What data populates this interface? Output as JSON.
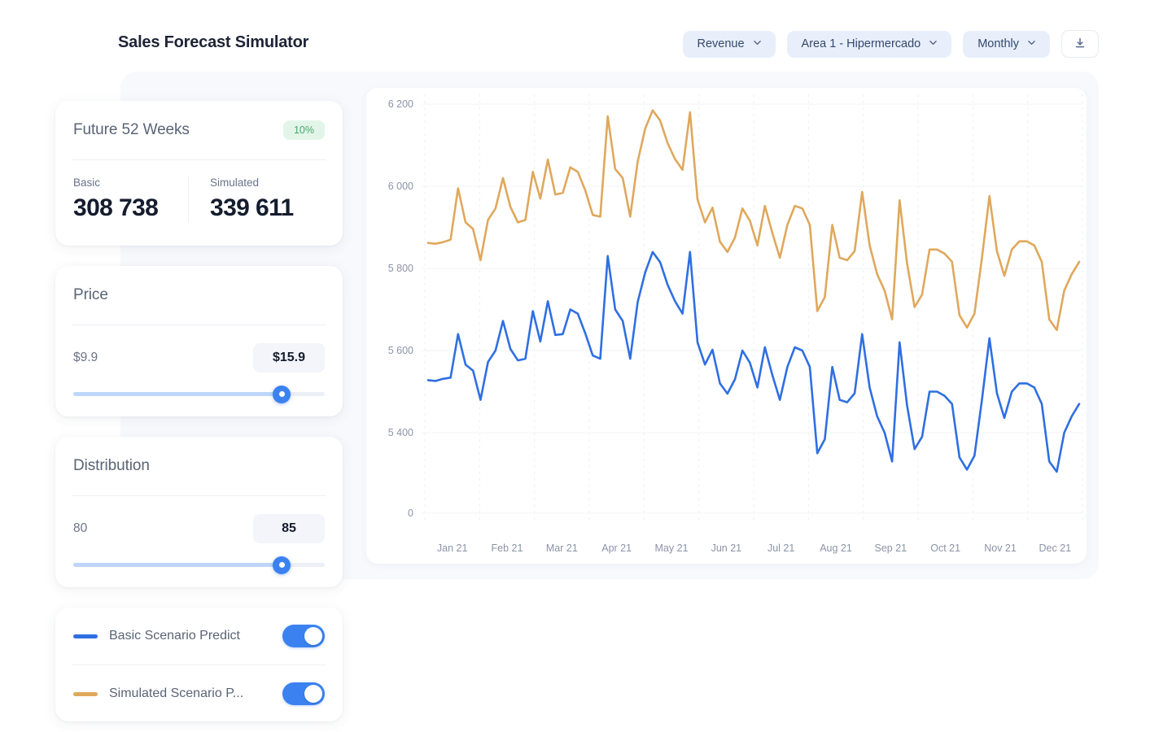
{
  "header": {
    "title": "Sales Forecast Simulator",
    "controls": [
      {
        "name": "metric",
        "label": "Revenue",
        "icon": "chevron-down-icon"
      },
      {
        "name": "area",
        "label": "Area 1 - Hipermercado",
        "icon": "chevron-down-icon"
      },
      {
        "name": "granularity",
        "label": "Monthly",
        "icon": "chevron-down-icon"
      }
    ],
    "download": {
      "icon": "download-icon",
      "label": ""
    }
  },
  "summary": {
    "title": "Future 52 Weeks",
    "badge": "10%",
    "basic_label": "Basic",
    "basic_value": "308 738",
    "simulated_label": "Simulated",
    "simulated_value": "339 611"
  },
  "price": {
    "title": "Price",
    "min_label": "$9.9",
    "value_label": "$15.9",
    "slider_percent": 83
  },
  "distribution": {
    "title": "Distribution",
    "min_label": "80",
    "value_label": "85",
    "slider_percent": 83
  },
  "legend": {
    "items": [
      {
        "label": "Basic Scenario Predict",
        "color": "#2f6fe2",
        "enabled": true
      },
      {
        "label": "Simulated Scenario P...",
        "color": "#dfa85c",
        "enabled": true
      }
    ]
  },
  "colors": {
    "basic": "#2f6fe2",
    "simulated": "#dfa85c",
    "accent": "#3b82f0",
    "badge_bg": "#e3f5e9",
    "badge_text": "#46a86b",
    "pill_bg": "#e8effb",
    "pill_text": "#33486c",
    "backdrop": "#f8f9fd"
  },
  "chart_data": {
    "type": "line",
    "title": "",
    "xlabel": "",
    "ylabel": "",
    "grid": true,
    "legend_position": "external-left",
    "ylim": [
      5300,
      6280
    ],
    "y_ticks": [
      "6 200",
      "6 000",
      "5 800",
      "5 600",
      "5 400",
      "0"
    ],
    "y_tick_values": [
      6200,
      6000,
      5800,
      5600,
      5400,
      0
    ],
    "y_axis_broken": true,
    "x_ticks": [
      "Jan 21",
      "Feb 21",
      "Mar 21",
      "Apr 21",
      "May 21",
      "Jun 21",
      "Jul 21",
      "Aug 21",
      "Sep 21",
      "Oct 21",
      "Nov 21",
      "Dec 21"
    ],
    "series": [
      {
        "name": "Basic Scenario Predict",
        "color": "#2f6fe2",
        "values": [
          5528,
          5526,
          5531,
          5534,
          5640,
          5566,
          5551,
          5480,
          5572,
          5600,
          5672,
          5604,
          5576,
          5580,
          5696,
          5622,
          5720,
          5638,
          5640,
          5700,
          5690,
          5642,
          5588,
          5580,
          5830,
          5700,
          5672,
          5580,
          5718,
          5790,
          5840,
          5815,
          5760,
          5720,
          5690,
          5840,
          5620,
          5566,
          5602,
          5520,
          5495,
          5530,
          5600,
          5570,
          5510,
          5608,
          5540,
          5480,
          5560,
          5608,
          5600,
          5560,
          5350,
          5384,
          5560,
          5480,
          5474,
          5496,
          5640,
          5510,
          5440,
          5400,
          5330,
          5620,
          5466,
          5360,
          5390,
          5500,
          5500,
          5490,
          5470,
          5340,
          5310,
          5344,
          5480,
          5630,
          5496,
          5436,
          5500,
          5520,
          5520,
          5510,
          5470,
          5330,
          5305,
          5400,
          5440,
          5470
        ]
      },
      {
        "name": "Simulated Scenario Predict",
        "color": "#dfa85c",
        "values": [
          5862,
          5860,
          5864,
          5870,
          5995,
          5912,
          5896,
          5820,
          5918,
          5946,
          6020,
          5950,
          5912,
          5918,
          6035,
          5970,
          6065,
          5980,
          5984,
          6046,
          6035,
          5990,
          5930,
          5926,
          6170,
          6042,
          6020,
          5926,
          6060,
          6140,
          6185,
          6160,
          6105,
          6066,
          6040,
          6180,
          5968,
          5912,
          5948,
          5865,
          5840,
          5875,
          5946,
          5916,
          5856,
          5952,
          5886,
          5826,
          5906,
          5952,
          5946,
          5906,
          5696,
          5730,
          5906,
          5826,
          5820,
          5842,
          5986,
          5856,
          5786,
          5746,
          5676,
          5966,
          5812,
          5706,
          5736,
          5846,
          5846,
          5836,
          5816,
          5686,
          5656,
          5690,
          5826,
          5976,
          5842,
          5782,
          5846,
          5866,
          5866,
          5856,
          5816,
          5676,
          5650,
          5746,
          5786,
          5816
        ]
      }
    ]
  }
}
